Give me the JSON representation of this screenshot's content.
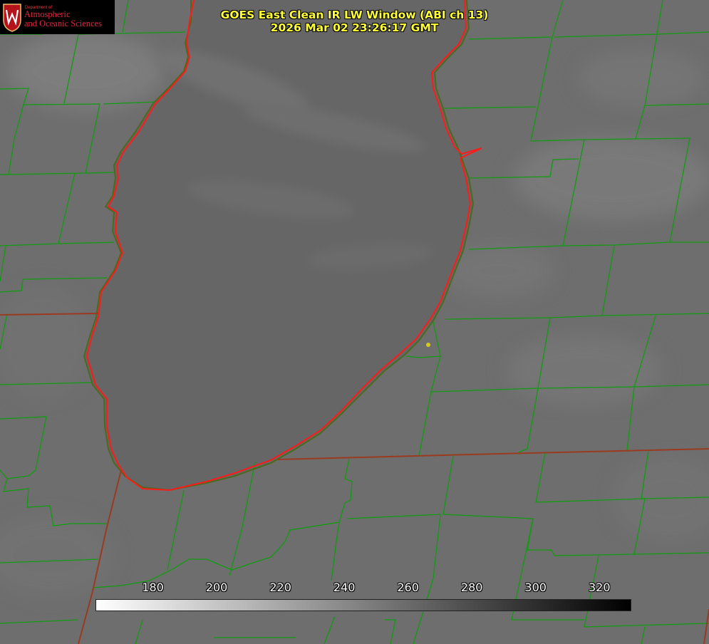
{
  "logo": {
    "dept": "Department of",
    "line1": "Atmospheric",
    "line2": "and Oceanic Sciences",
    "seal_color": "#b5121b"
  },
  "title": {
    "line1": "GOES East Clean IR LW Window (ABI ch 13)",
    "line2": "2026 Mar 02 23:26:17 GMT"
  },
  "colorbar": {
    "ticks": [
      180,
      200,
      220,
      240,
      260,
      280,
      300,
      320
    ],
    "min": 162,
    "max": 330,
    "colors": {
      "low": "#ffffff",
      "high": "#000000"
    }
  },
  "map": {
    "county_color": "#109c10",
    "state_color": "#c0392b",
    "lake_shore_color": "#ff1a1a",
    "marker_color": "#d6c81c"
  }
}
